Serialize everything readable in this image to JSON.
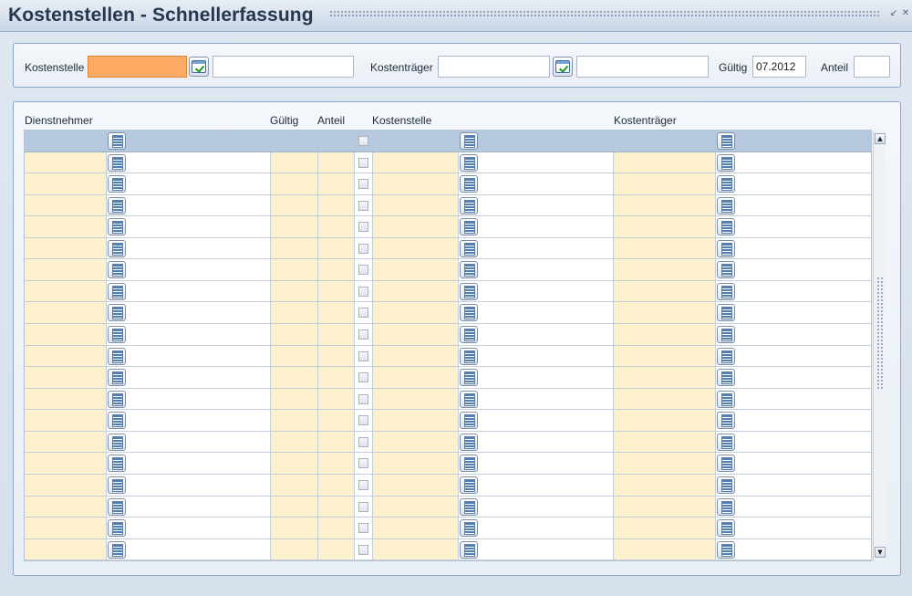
{
  "window": {
    "title": "Kostenstellen - Schnellerfassung",
    "minimize_icon": "minimize-icon",
    "close_icon": "close-icon"
  },
  "entry": {
    "kostenstelle_label": "Kostenstelle",
    "kostenstelle_value": "",
    "kostenstelle_desc": "",
    "kostentraeger_label": "Kostenträger",
    "kostentraeger_value": "",
    "kostentraeger_desc": "",
    "gueltig_label": "Gültig",
    "gueltig_value": "07.2012",
    "anteil_label": "Anteil",
    "anteil_value": ""
  },
  "table": {
    "headers": {
      "dienstnehmer": "Dienstnehmer",
      "gueltig": "Gültig",
      "anteil": "Anteil",
      "kostenstelle": "Kostenstelle",
      "kostentraeger": "Kostenträger"
    },
    "row_count": 19
  },
  "colors": {
    "active_field": "#fba963",
    "editable_cell": "#fdf0cd",
    "filter_row": "#b6c8dd"
  }
}
